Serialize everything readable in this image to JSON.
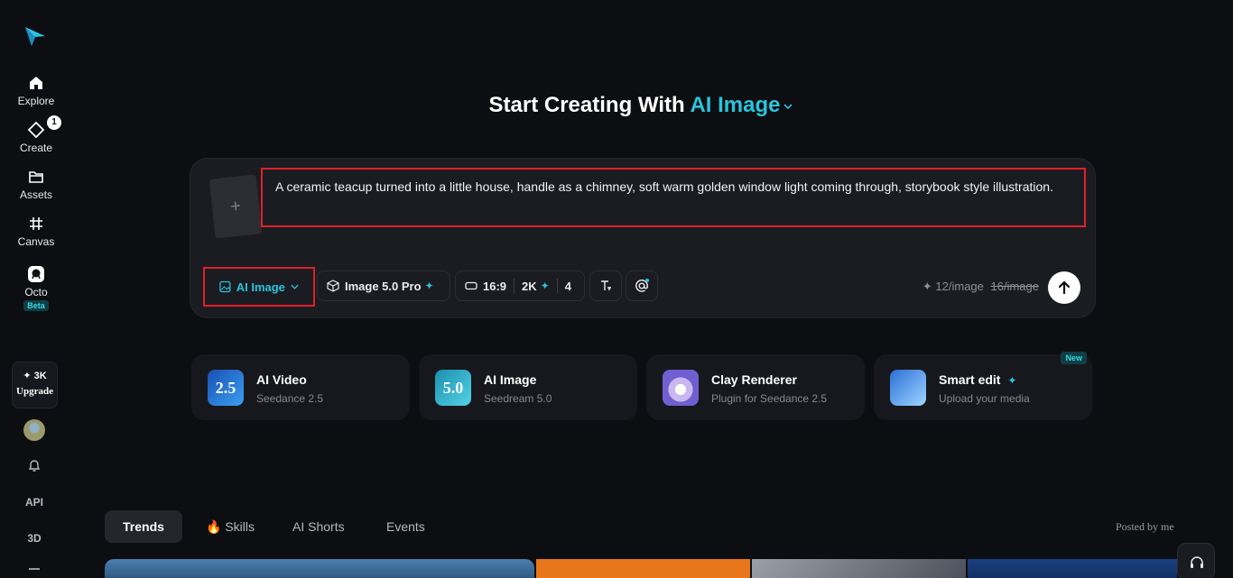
{
  "sidebar": {
    "items": [
      {
        "label": "Explore",
        "icon": "home-icon"
      },
      {
        "label": "Create",
        "icon": "diamond-icon",
        "badge": "1"
      },
      {
        "label": "Assets",
        "icon": "folder-icon"
      },
      {
        "label": "Canvas",
        "icon": "grid-icon"
      },
      {
        "label": "Octo",
        "icon": "octo-icon",
        "tag": "Beta"
      }
    ],
    "credits": "✦ 3K",
    "upgrade_label": "Upgrade",
    "api_label": "API",
    "three_d_label": "3D"
  },
  "header": {
    "title_prefix": "Start Creating With",
    "title_accent": "AI Image"
  },
  "prompt": {
    "text": "A ceramic teacup turned into a little house, handle as a chimney, soft warm golden window light coming through, storybook style illustration.",
    "upload_symbol": "+"
  },
  "toolbar": {
    "mode_label": "AI Image",
    "model_label": "Image 5.0 Pro",
    "ratio_label": "16:9",
    "quality_label": "2K",
    "count_label": "4",
    "price_current": "12/image",
    "price_old": "16/image"
  },
  "features": [
    {
      "title": "AI Video",
      "subtitle": "Seedance 2.5",
      "thumb_text": "2.5"
    },
    {
      "title": "AI Image",
      "subtitle": "Seedream 5.0",
      "thumb_text": "5.0"
    },
    {
      "title": "Clay Renderer",
      "subtitle": "Plugin for Seedance 2.5",
      "thumb_text": ""
    },
    {
      "title": "Smart edit",
      "subtitle": "Upload your media",
      "thumb_text": "",
      "tag": "New"
    }
  ],
  "tabs": [
    {
      "label": "Trends"
    },
    {
      "label": "🔥 Skills"
    },
    {
      "label": "AI Shorts"
    },
    {
      "label": "Events"
    }
  ],
  "posted_by": "Posted by me",
  "colors": {
    "accent": "#29c4dc",
    "highlight": "#e02027",
    "background": "#0d0e11"
  }
}
